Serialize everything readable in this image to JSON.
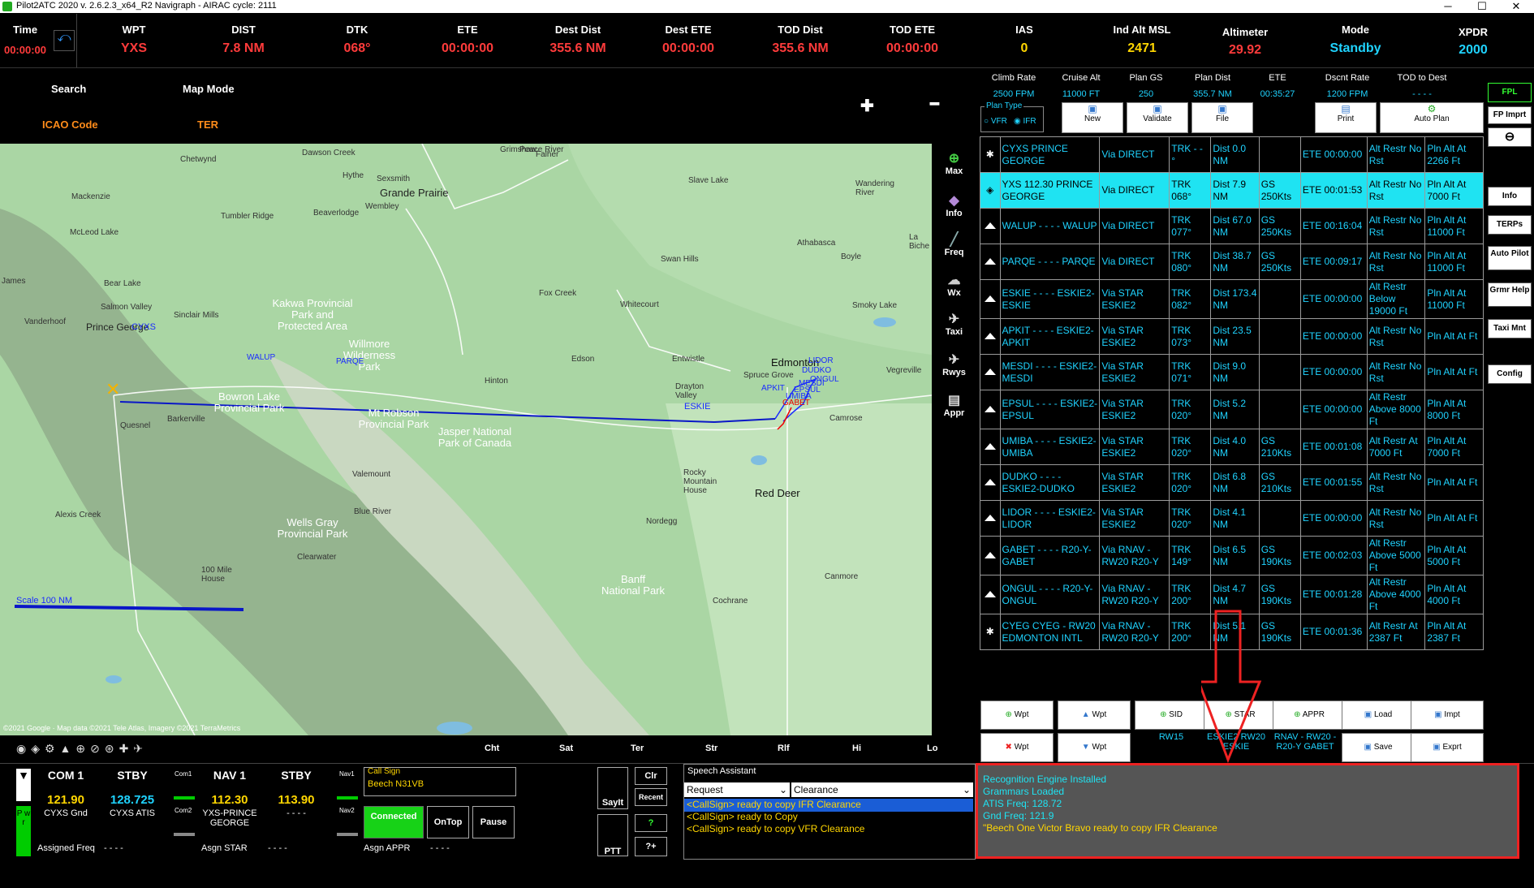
{
  "window": {
    "title": "Pilot2ATC 2020 v. 2.6.2.3_x64_R2     Navigraph - AIRAC cycle: 2111",
    "min": "─",
    "max": "☐",
    "close": "✕"
  },
  "topbar": {
    "time": {
      "label": "Time",
      "value": "00:00:00"
    },
    "wpt": {
      "label": "WPT",
      "value": "YXS"
    },
    "dist": {
      "label": "DIST",
      "value": "7.8 NM"
    },
    "dtk": {
      "label": "DTK",
      "value": "068°"
    },
    "ete": {
      "label": "ETE",
      "value": "00:00:00"
    },
    "dest_dist": {
      "label": "Dest Dist",
      "value": "355.6 NM"
    },
    "dest_ete": {
      "label": "Dest ETE",
      "value": "00:00:00"
    },
    "tod_dist": {
      "label": "TOD Dist",
      "value": "355.6 NM"
    },
    "tod_ete": {
      "label": "TOD ETE",
      "value": "00:00:00"
    },
    "ias": {
      "label": "IAS",
      "value": "0"
    },
    "ind_alt": {
      "label": "Ind Alt MSL",
      "value": "2471"
    },
    "altimeter": {
      "label": "Altimeter",
      "value": "29.92"
    },
    "mode": {
      "label": "Mode",
      "value": "Standby"
    },
    "xpdr": {
      "label": "XPDR",
      "value": "2000"
    }
  },
  "map_header": {
    "search": "Search",
    "map_mode": "Map Mode",
    "icao": "ICAO Code",
    "ter": "TER",
    "plus": "✚",
    "minus": "━"
  },
  "map_side": [
    "Max",
    "Info",
    "Freq",
    "Wx",
    "Taxi",
    "Rwys",
    "Appr"
  ],
  "map_labels": [
    "Prince George",
    "CYXS",
    "Grande Prairie",
    "Edmonton",
    "Red Deer",
    "Jasper National Park of Canada",
    "Kakwa Provincial Park and Protected Area",
    "Willmore Wilderness Park",
    "Bowron Lake Provincial Park",
    "Wells Gray Provincial Park",
    "Mt Robson Provincial Park",
    "Hinton",
    "Edson",
    "Whitecourt",
    "Athabasca",
    "Slave Lake",
    "Peace River",
    "Camrose",
    "Drayton Valley",
    "Rocky Mountain House",
    "Banff National Park",
    "Quesnel",
    "100 Mile House",
    "Valemount",
    "ESKIE",
    "APKIT",
    "LIDOR",
    "DUDKO",
    "ONGUL",
    "GABET",
    "WALUP",
    "PARQE",
    "UMIBA",
    "EPSUL",
    "MESDI",
    "Mackenzie",
    "McLeod Lake",
    "Bear Lake",
    "Chetwynd",
    "Tumbler Ridge",
    "Dawson Creek",
    "Beaverlodge",
    "Sexsmith",
    "Fox Creek",
    "Swan Hills",
    "Wembley",
    "Hythe",
    "Falher",
    "Grimshaw",
    "Wandering River",
    "Boyle",
    "La Biche",
    "Smoky Lake",
    "Vegreville",
    "Entwistle",
    "Spruce Grove",
    "Sinclair Mills",
    "Salmon Valley",
    "Vanderhoof",
    "James",
    "Alexis Creek",
    "Barkerville",
    "Blue River",
    "Clearwater",
    "Nordegg",
    "Canmore",
    "Cochrane"
  ],
  "map_scale": "Scale 100 NM",
  "map_copyright": "©2021 Google · Map data ©2021 Tele Atlas, Imagery ©2021 TerraMetrics",
  "map_footer": [
    "Cht",
    "Sat",
    "Ter",
    "Str",
    "Rlf",
    "Hi",
    "Lo"
  ],
  "plan_stats": [
    {
      "label": "Climb Rate",
      "value": "2500 FPM"
    },
    {
      "label": "Cruise Alt",
      "value": "11000 FT"
    },
    {
      "label": "Plan GS",
      "value": "250"
    },
    {
      "label": "Plan Dist",
      "value": "355.7 NM"
    },
    {
      "label": "ETE",
      "value": "00:35:27"
    },
    {
      "label": "Dscnt Rate",
      "value": "1200 FPM"
    },
    {
      "label": "TOD to Dest",
      "value": "- - - -"
    }
  ],
  "plan_type": {
    "label": "Plan Type",
    "vfr": "VFR",
    "ifr": "IFR"
  },
  "plan_buttons": [
    "New",
    "Validate",
    "File",
    "Print",
    "Auto Plan"
  ],
  "waypoints": [
    {
      "c1": "CYXS  PRINCE GEORGE",
      "c2": "Via DIRECT",
      "c3": "TRK - - °",
      "c4": "Dist 0.0 NM",
      "c5": "",
      "c6": "ETE 00:00:00",
      "c7": "Alt Restr No Rst",
      "c8": "Pln Alt At 2266 Ft",
      "icon": "airport",
      "sel": false
    },
    {
      "c1": "YXS  112.30 PRINCE GEORGE",
      "c2": "Via DIRECT",
      "c3": "TRK 068°",
      "c4": "Dist 7.9 NM",
      "c5": "GS 250Kts",
      "c6": "ETE 00:01:53",
      "c7": "Alt Restr No Rst",
      "c8": "Pln Alt At 7000 Ft",
      "icon": "vor",
      "sel": true
    },
    {
      "c1": "WALUP  - - - - WALUP",
      "c2": "Via DIRECT",
      "c3": "TRK 077°",
      "c4": "Dist 67.0 NM",
      "c5": "GS 250Kts",
      "c6": "ETE 00:16:04",
      "c7": "Alt Restr No Rst",
      "c8": "Pln Alt At 11000 Ft",
      "icon": "tri",
      "sel": false
    },
    {
      "c1": "PARQE  - - - - PARQE",
      "c2": "Via DIRECT",
      "c3": "TRK 080°",
      "c4": "Dist 38.7 NM",
      "c5": "GS 250Kts",
      "c6": "ETE 00:09:17",
      "c7": "Alt Restr No Rst",
      "c8": "Pln Alt At 11000 Ft",
      "icon": "tri",
      "sel": false
    },
    {
      "c1": "ESKIE  - - - - ESKIE2-ESKIE",
      "c2": "Via STAR ESKIE2",
      "c3": "TRK 082°",
      "c4": "Dist 173.4 NM",
      "c5": "",
      "c6": "ETE 00:00:00",
      "c7": "Alt Restr Below 19000 Ft",
      "c8": "Pln Alt At 11000 Ft",
      "icon": "tri",
      "sel": false
    },
    {
      "c1": "APKIT  - - - - ESKIE2-APKIT",
      "c2": "Via STAR ESKIE2",
      "c3": "TRK 073°",
      "c4": "Dist 23.5 NM",
      "c5": "",
      "c6": "ETE 00:00:00",
      "c7": "Alt Restr No Rst",
      "c8": "Pln Alt At  Ft",
      "icon": "tri",
      "sel": false
    },
    {
      "c1": "MESDI  - - - - ESKIE2-MESDI",
      "c2": "Via STAR ESKIE2",
      "c3": "TRK 071°",
      "c4": "Dist 9.0 NM",
      "c5": "",
      "c6": "ETE 00:00:00",
      "c7": "Alt Restr No Rst",
      "c8": "Pln Alt At  Ft",
      "icon": "tri",
      "sel": false
    },
    {
      "c1": "EPSUL  - - - - ESKIE2-EPSUL",
      "c2": "Via STAR ESKIE2",
      "c3": "TRK 020°",
      "c4": "Dist 5.2 NM",
      "c5": "",
      "c6": "ETE 00:00:00",
      "c7": "Alt Restr Above 8000 Ft",
      "c8": "Pln Alt At 8000 Ft",
      "icon": "tri",
      "sel": false
    },
    {
      "c1": "UMIBA  - - - - ESKIE2-UMIBA",
      "c2": "Via STAR ESKIE2",
      "c3": "TRK 020°",
      "c4": "Dist 4.0 NM",
      "c5": "GS 210Kts",
      "c6": "ETE 00:01:08",
      "c7": "Alt Restr At 7000 Ft",
      "c8": "Pln Alt At 7000 Ft",
      "icon": "tri",
      "sel": false
    },
    {
      "c1": "DUDKO  - - - - ESKIE2-DUDKO",
      "c2": "Via STAR ESKIE2",
      "c3": "TRK 020°",
      "c4": "Dist 6.8 NM",
      "c5": "GS 210Kts",
      "c6": "ETE 00:01:55",
      "c7": "Alt Restr No Rst",
      "c8": "Pln Alt At  Ft",
      "icon": "tri",
      "sel": false
    },
    {
      "c1": "LIDOR  - - - - ESKIE2-LIDOR",
      "c2": "Via STAR ESKIE2",
      "c3": "TRK 020°",
      "c4": "Dist 4.1 NM",
      "c5": "",
      "c6": "ETE 00:00:00",
      "c7": "Alt Restr No Rst",
      "c8": "Pln Alt At  Ft",
      "icon": "tri",
      "sel": false
    },
    {
      "c1": "GABET  - - - - R20-Y-GABET",
      "c2": "Via RNAV - RW20 R20-Y",
      "c3": "TRK 149°",
      "c4": "Dist 6.5 NM",
      "c5": "GS 190Kts",
      "c6": "ETE 00:02:03",
      "c7": "Alt Restr Above 5000 Ft",
      "c8": "Pln Alt At 5000 Ft",
      "icon": "tri",
      "sel": false
    },
    {
      "c1": "ONGUL  - - - - R20-Y-ONGUL",
      "c2": "Via RNAV - RW20 R20-Y",
      "c3": "TRK 200°",
      "c4": "Dist 4.7 NM",
      "c5": "GS 190Kts",
      "c6": "ETE 00:01:28",
      "c7": "Alt Restr Above 4000 Ft",
      "c8": "Pln Alt At 4000 Ft",
      "icon": "tri",
      "sel": false
    },
    {
      "c1": "CYEG  CYEG - RW20 EDMONTON INTL",
      "c2": "Via RNAV - RW20 R20-Y",
      "c3": "TRK 200°",
      "c4": "Dist 5.1 NM",
      "c5": "GS 190Kts",
      "c6": "ETE 00:01:36",
      "c7": "Alt Restr At 2387 Ft",
      "c8": "Pln Alt At 2387 Ft",
      "icon": "airport",
      "sel": false
    }
  ],
  "fp_buttons_row1": [
    "Wpt",
    "Wpt",
    "SID",
    "STAR",
    "APPR",
    "Load",
    "Impt"
  ],
  "fp_buttons_row2": [
    "Wpt",
    "Wpt",
    "Save",
    "Exprt"
  ],
  "fp_sub": {
    "sid": "RW15",
    "star": "ESKIE2 RW20 ESKIE",
    "appr": "RNAV - RW20 - R20-Y GABET"
  },
  "side_buttons": [
    "FPL",
    "FP Imprt",
    "Info",
    "TERPs",
    "Auto Pilot",
    "Grmr Help",
    "Taxi Mnt",
    "Config"
  ],
  "radios": {
    "com1": {
      "label": "COM 1",
      "freq": "121.90",
      "sub": "CYXS Gnd"
    },
    "stby1": {
      "label": "STBY",
      "freq": "128.725",
      "sub": "CYXS ATIS"
    },
    "nav1": {
      "label": "NAV 1",
      "freq": "112.30",
      "sub": "YXS-PRINCE GEORGE"
    },
    "stby2": {
      "label": "STBY",
      "freq": "113.90",
      "sub": "- - - -"
    },
    "com1_small": "Com1",
    "com2_small": "Com2",
    "nav1_small": "Nav1",
    "nav2_small": "Nav2",
    "assigned_freq": "Assigned Freq",
    "assigned_freq_val": "- - - -",
    "asgn_star": "Asgn STAR",
    "asgn_star_val": "- - - -",
    "asgn_appr": "Asgn APPR",
    "asgn_appr_val": "- - - -",
    "pwr": "P w r"
  },
  "callsign": {
    "label": "Call Sign",
    "value": "Beech N31VB"
  },
  "control_buttons": {
    "connected": "Connected",
    "ontop": "OnTop",
    "pause": "Pause"
  },
  "speech": {
    "title": "Speech Assistant",
    "sayit": "SayIt",
    "ptt": "PTT",
    "clr": "Clr",
    "recent": "Recent",
    "q": "?",
    "qplus": "?+",
    "request": "Request",
    "clearance": "Clearance",
    "items": [
      "<CallSign> ready to copy IFR Clearance",
      "<CallSign> ready to Copy",
      "<CallSign> ready to copy VFR Clearance"
    ]
  },
  "console": {
    "lines": [
      "Recognition Engine Installed",
      "Grammars Loaded",
      "ATIS Freq: 128.72",
      "Gnd Freq: 121.9",
      "\"Beech One Victor Bravo ready to copy IFR Clearance"
    ]
  }
}
